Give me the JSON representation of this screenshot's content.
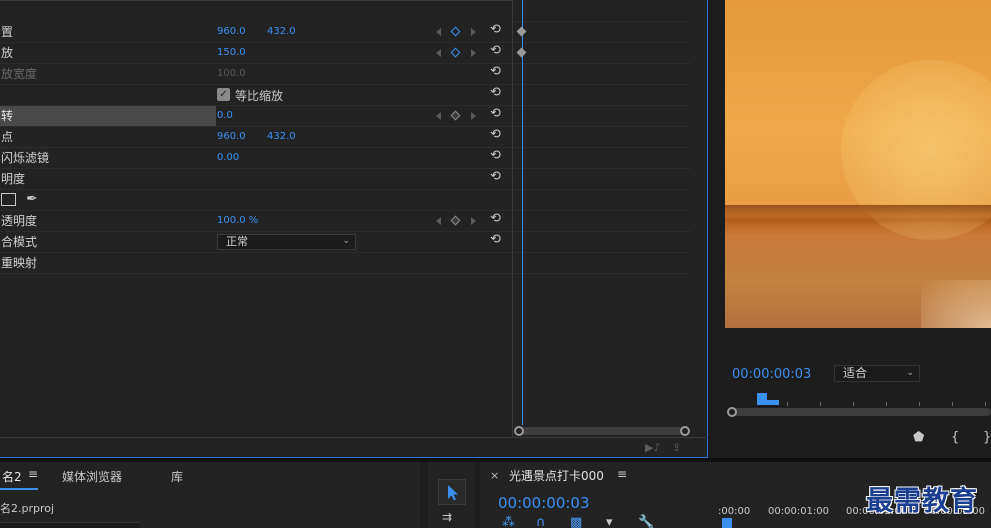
{
  "effect_controls": {
    "rows": [
      {
        "name": "置",
        "v1": "960.0",
        "v2": "432.0"
      },
      {
        "name": "放",
        "v1": "150.0"
      },
      {
        "name": "放宽度",
        "v1": "100.0"
      },
      {
        "checkbox_label": "等比缩放"
      },
      {
        "name": "转",
        "v1": "0.0"
      },
      {
        "name": "点",
        "v1": "960.0",
        "v2": "432.0"
      },
      {
        "name": "闪烁滤镜",
        "v1": "0.00"
      },
      {
        "name": "明度"
      },
      {},
      {
        "name": "透明度",
        "v1": "100.0 %"
      },
      {
        "name": "合模式",
        "select": "正常"
      },
      {
        "name": "重映射"
      }
    ],
    "reset_icon": "⟲",
    "footer_icons": [
      "play-audio-icon",
      "export-icon"
    ]
  },
  "program_monitor": {
    "timecode": "00:00:00:03",
    "fit": "适合",
    "controls": [
      "add-marker-icon",
      "mark-in-icon",
      "mark-out-icon"
    ]
  },
  "project_panel": {
    "tabs": [
      "名2",
      "媒体浏览器",
      "库"
    ],
    "menu_icon": "≡",
    "file": "名2.prproj"
  },
  "sequence_panel": {
    "title": "光遇景点打卡000",
    "menu_icon": "≡",
    "timecode": "00:00:00:03",
    "ruler_times": [
      ":00:00",
      "00:00:01:00",
      "00:00:02:00",
      "00:00:03:00"
    ]
  },
  "watermark": "最需教育",
  "colors": {
    "accent": "#3b8ff0",
    "panel": "#232323"
  }
}
